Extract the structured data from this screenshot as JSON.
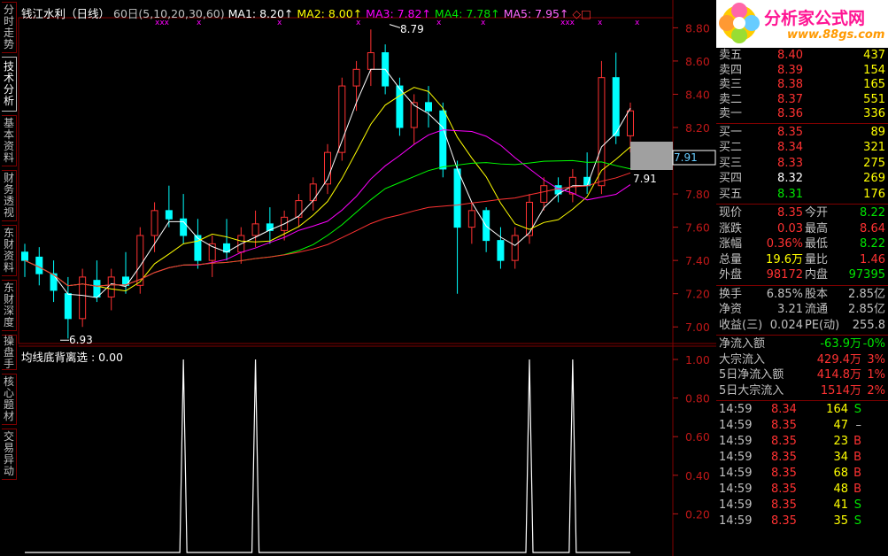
{
  "sidebar": {
    "tabs": [
      "分时走势",
      "技术分析",
      "基本资料",
      "财务透视",
      "东财资料",
      "东财深度",
      "操盘手",
      "核心题材",
      "交易异动"
    ],
    "active_index": 1
  },
  "main_legend": {
    "title": "钱江水利（日线）",
    "params": "60日(5,10,20,30,60)",
    "ma1": "MA1: 8.20↑",
    "ma2": "MA2: 8.00↑",
    "ma3": "MA3: 7.82↑",
    "ma4": "MA4: 7.78↑",
    "ma5": "MA5: 7.95↑",
    "markers": "◇□"
  },
  "indicator_legend": "均线底背离选 : 0.00",
  "price_axis": [
    "8.80",
    "8.60",
    "8.40",
    "8.20",
    "8.00",
    "7.80",
    "7.60",
    "7.40",
    "7.20",
    "7.00"
  ],
  "indicator_axis": [
    "1.00",
    "0.80",
    "0.60",
    "0.40",
    "0.20"
  ],
  "annotations": {
    "high": "8.79",
    "low": "6.93",
    "current": "7.91",
    "price_tag": "7.91"
  },
  "colors": {
    "up": "#ff3232",
    "down": "#00ffff",
    "ma1": "#ffffff",
    "ma2": "#ffff00",
    "ma3": "#ff00ff",
    "ma4": "#00ff00",
    "ma5": "#c0c0c0",
    "ma60": "#ff3232",
    "grid": "#800000",
    "axis_text": "#c01818"
  },
  "chart_data": {
    "type": "candlestick",
    "ylim": [
      6.9,
      8.85
    ],
    "candles": [
      {
        "o": 7.45,
        "h": 7.5,
        "l": 7.3,
        "c": 7.4
      },
      {
        "o": 7.42,
        "h": 7.48,
        "l": 7.25,
        "c": 7.32
      },
      {
        "o": 7.32,
        "h": 7.4,
        "l": 7.15,
        "c": 7.22
      },
      {
        "o": 7.2,
        "h": 7.3,
        "l": 6.93,
        "c": 7.05
      },
      {
        "o": 7.05,
        "h": 7.35,
        "l": 7.0,
        "c": 7.3
      },
      {
        "o": 7.28,
        "h": 7.4,
        "l": 7.15,
        "c": 7.18
      },
      {
        "o": 7.18,
        "h": 7.35,
        "l": 7.1,
        "c": 7.3
      },
      {
        "o": 7.3,
        "h": 7.45,
        "l": 7.2,
        "c": 7.25
      },
      {
        "o": 7.25,
        "h": 7.6,
        "l": 7.2,
        "c": 7.55
      },
      {
        "o": 7.55,
        "h": 7.75,
        "l": 7.45,
        "c": 7.7
      },
      {
        "o": 7.7,
        "h": 7.85,
        "l": 7.6,
        "c": 7.65
      },
      {
        "o": 7.65,
        "h": 7.8,
        "l": 7.5,
        "c": 7.55
      },
      {
        "o": 7.55,
        "h": 7.65,
        "l": 7.35,
        "c": 7.4
      },
      {
        "o": 7.4,
        "h": 7.55,
        "l": 7.3,
        "c": 7.5
      },
      {
        "o": 7.5,
        "h": 7.65,
        "l": 7.4,
        "c": 7.45
      },
      {
        "o": 7.45,
        "h": 7.6,
        "l": 7.38,
        "c": 7.55
      },
      {
        "o": 7.55,
        "h": 7.7,
        "l": 7.48,
        "c": 7.62
      },
      {
        "o": 7.62,
        "h": 7.72,
        "l": 7.5,
        "c": 7.58
      },
      {
        "o": 7.58,
        "h": 7.7,
        "l": 7.52,
        "c": 7.66
      },
      {
        "o": 7.66,
        "h": 7.8,
        "l": 7.6,
        "c": 7.76
      },
      {
        "o": 7.76,
        "h": 7.9,
        "l": 7.7,
        "c": 7.86
      },
      {
        "o": 7.86,
        "h": 8.1,
        "l": 7.8,
        "c": 8.05
      },
      {
        "o": 8.05,
        "h": 8.5,
        "l": 8.0,
        "c": 8.45
      },
      {
        "o": 8.45,
        "h": 8.6,
        "l": 8.3,
        "c": 8.55
      },
      {
        "o": 8.55,
        "h": 8.79,
        "l": 8.45,
        "c": 8.65
      },
      {
        "o": 8.65,
        "h": 8.7,
        "l": 8.4,
        "c": 8.45
      },
      {
        "o": 8.45,
        "h": 8.5,
        "l": 8.15,
        "c": 8.2
      },
      {
        "o": 8.2,
        "h": 8.4,
        "l": 8.1,
        "c": 8.35
      },
      {
        "o": 8.35,
        "h": 8.45,
        "l": 8.2,
        "c": 8.3
      },
      {
        "o": 8.3,
        "h": 8.35,
        "l": 7.9,
        "c": 7.95
      },
      {
        "o": 7.95,
        "h": 8.0,
        "l": 7.2,
        "c": 7.6
      },
      {
        "o": 7.6,
        "h": 7.75,
        "l": 7.5,
        "c": 7.7
      },
      {
        "o": 7.7,
        "h": 7.72,
        "l": 7.45,
        "c": 7.52
      },
      {
        "o": 7.52,
        "h": 7.6,
        "l": 7.35,
        "c": 7.4
      },
      {
        "o": 7.4,
        "h": 7.6,
        "l": 7.35,
        "c": 7.55
      },
      {
        "o": 7.55,
        "h": 7.8,
        "l": 7.5,
        "c": 7.75
      },
      {
        "o": 7.75,
        "h": 7.9,
        "l": 7.7,
        "c": 7.85
      },
      {
        "o": 7.85,
        "h": 7.9,
        "l": 7.75,
        "c": 7.8
      },
      {
        "o": 7.8,
        "h": 7.95,
        "l": 7.75,
        "c": 7.9
      },
      {
        "o": 7.9,
        "h": 8.05,
        "l": 7.8,
        "c": 7.85
      },
      {
        "o": 7.85,
        "h": 8.6,
        "l": 7.8,
        "c": 8.5
      },
      {
        "o": 8.5,
        "h": 8.65,
        "l": 8.1,
        "c": 8.15
      },
      {
        "o": 8.15,
        "h": 8.35,
        "l": 8.05,
        "c": 8.3
      }
    ],
    "indicator_peaks_at_candle_index": [
      11,
      16,
      35,
      38
    ],
    "indicator_ylim": [
      0,
      1.0
    ]
  },
  "right_panel": {
    "asks": [
      {
        "label": "卖五",
        "price": "8.40",
        "vol": "437"
      },
      {
        "label": "卖四",
        "price": "8.39",
        "vol": "154"
      },
      {
        "label": "卖三",
        "price": "8.38",
        "vol": "165"
      },
      {
        "label": "卖二",
        "price": "8.37",
        "vol": "551"
      },
      {
        "label": "卖一",
        "price": "8.36",
        "vol": "336"
      }
    ],
    "bids": [
      {
        "label": "买一",
        "price": "8.35",
        "vol": "89"
      },
      {
        "label": "买二",
        "price": "8.34",
        "vol": "321"
      },
      {
        "label": "买三",
        "price": "8.33",
        "vol": "275"
      },
      {
        "label": "买四",
        "price": "8.32",
        "vol": "269"
      },
      {
        "label": "买五",
        "price": "8.31",
        "vol": "176"
      }
    ],
    "stats": [
      {
        "l1": "现价",
        "v1": "8.35",
        "l2": "今开",
        "v2": "8.22"
      },
      {
        "l1": "涨跌",
        "v1": "0.03",
        "l2": "最高",
        "v2": "8.64"
      },
      {
        "l1": "涨幅",
        "v1": "0.36%",
        "l2": "最低",
        "v2": "8.22"
      },
      {
        "l1": "总量",
        "v1": "19.6万",
        "l2": "量比",
        "v2": "1.46"
      },
      {
        "l1": "外盘",
        "v1": "98172",
        "l2": "内盘",
        "v2": "97395"
      }
    ],
    "fundamentals": [
      {
        "l1": "换手",
        "v1": "6.85%",
        "l2": "股本",
        "v2": "2.85亿"
      },
      {
        "l1": "净资",
        "v1": "3.21",
        "l2": "流通",
        "v2": "2.85亿"
      },
      {
        "l1": "收益(三)",
        "v1": "0.024",
        "l2": "PE(动)",
        "v2": "255.8"
      }
    ],
    "flows": [
      {
        "label": "净流入额",
        "value": "-63.9万",
        "pct": "-0%"
      },
      {
        "label": "大宗流入",
        "value": "429.4万",
        "pct": "3%"
      },
      {
        "label": "5日净流入额",
        "value": "414.8万",
        "pct": "1%"
      },
      {
        "label": "5日大宗流入",
        "value": "1514万",
        "pct": "2%"
      }
    ],
    "ticks": [
      {
        "time": "14:59",
        "price": "8.34",
        "vol": "164",
        "side": "S"
      },
      {
        "time": "14:59",
        "price": "8.35",
        "vol": "47",
        "side": "–"
      },
      {
        "time": "14:59",
        "price": "8.35",
        "vol": "23",
        "side": "B"
      },
      {
        "time": "14:59",
        "price": "8.35",
        "vol": "34",
        "side": "B"
      },
      {
        "time": "14:59",
        "price": "8.35",
        "vol": "68",
        "side": "B"
      },
      {
        "time": "14:59",
        "price": "8.35",
        "vol": "48",
        "side": "B"
      },
      {
        "time": "14:59",
        "price": "8.35",
        "vol": "41",
        "side": "S"
      },
      {
        "time": "14:59",
        "price": "8.35",
        "vol": "35",
        "side": "S"
      }
    ]
  },
  "logo": {
    "title": "分析家公式网",
    "url": "www.88gs.com"
  }
}
